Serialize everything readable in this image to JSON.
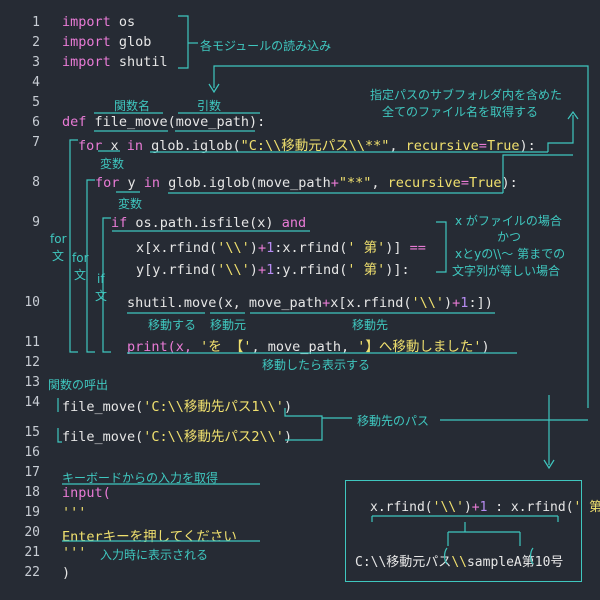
{
  "line_numbers": [
    "1",
    "2",
    "3",
    "4",
    "5",
    "6",
    "7",
    "8",
    "9",
    "10",
    "11",
    "12",
    "13",
    "14",
    "15",
    "16",
    "17",
    "18",
    "19",
    "20",
    "21",
    "22"
  ],
  "code": {
    "l1_kw": "import",
    "l1_mod": " os",
    "l2_kw": "import",
    "l2_mod": " glob",
    "l3_kw": "import",
    "l3_mod": " shutil",
    "l6_def": "def",
    "l6_name": " file_move",
    "l6_arg": "(move_path):",
    "l7_for": "for",
    "l7_x": " x ",
    "l7_in": "in",
    "l7_call": " glob.iglob(",
    "l7_str": "\"C:\\\\移動元パス\\\\**\"",
    "l7_comma": ", ",
    "l7_rec": "recursive",
    "l7_eq": "=",
    "l7_true": "True",
    "l7_end": "):",
    "l8_for": "for",
    "l8_y": " y ",
    "l8_in": "in",
    "l8_call": " glob.iglob(move_path",
    "l8_plus": "+",
    "l8_str": "\"**\"",
    "l8_comma": ", ",
    "l8_rec": "recursive",
    "l8_eq": "=",
    "l8_true": "True",
    "l8_end": "):",
    "l9_if": "if",
    "l9_call": " os.path.isfile(x) ",
    "l9_and": "and",
    "l9b_a": "x[x.rfind(",
    "l9b_s1": "'\\\\'",
    "l9b_p1": ")",
    "l9b_plus": "+",
    "l9b_one": "1",
    "l9b_b": ":x.rfind(",
    "l9b_s2": "' 第'",
    "l9b_c": ")] ",
    "l9b_eq": "==",
    "l9c_a": "y[y.rfind(",
    "l9c_s1": "'\\\\'",
    "l9c_p1": ")",
    "l9c_plus": "+",
    "l9c_one": "1",
    "l9c_b": ":y.rfind(",
    "l9c_s2": "' 第'",
    "l9c_c": ")]:",
    "l10_a": "shutil.move(x, move_path",
    "l10_plus": "+",
    "l10_b": "x[x.rfind(",
    "l10_s": "'\\\\'",
    "l10_c": ")",
    "l10_plus2": "+",
    "l10_one": "1",
    "l10_d": ":])",
    "l11_a": "print(x, ",
    "l11_s1": "'を 【'",
    "l11_b": ", move_path, ",
    "l11_s2": "'】へ移動しました'",
    "l11_c": ")",
    "l14_a": "file_move(",
    "l14_s": "'C:\\\\移動先パス1\\\\'",
    "l14_c": ")",
    "l15_a": "file_move(",
    "l15_s": "'C:\\\\移動先パス2\\\\'",
    "l15_c": ")",
    "l18": "input(",
    "l19": "'''",
    "l20": "Enterキーを押してください",
    "l21": "'''",
    "l22": ")"
  },
  "annotations": {
    "imports": "各モジュールの読み込み",
    "func_name": "関数名",
    "arg": "引数",
    "glob_desc_1": "指定パスのサブフォルダ内を含めた",
    "glob_desc_2": "全てのファイル名を取得する",
    "var_x": "変数",
    "var_y": "変数",
    "for_1a": "for",
    "for_1b": "文",
    "for_2a": "for",
    "for_2b": "文",
    "if_a": "if",
    "if_b": "文",
    "cond_1": "x がファイルの場合",
    "cond_2": "かつ",
    "cond_3": "xとyの\\\\～ 第までの",
    "cond_4": "文字列が等しい場合",
    "move": "移動する",
    "src": "移動元",
    "dst": "移動先",
    "after_move": "移動したら表示する",
    "call": "関数の呼出",
    "dest_path": "移動先のパス",
    "input_desc": "キーボードからの入力を取得",
    "input_shown": "入力時に表示される"
  },
  "diagram_box": {
    "expr_a": "x.rfind(",
    "expr_s1": "'\\\\'",
    "expr_b": ")",
    "expr_plus": "+",
    "expr_one": "1",
    "expr_sep": " : ",
    "expr_c": "x.rfind(",
    "expr_s2": "' 第'",
    "expr_d": ")",
    "path_a": "C:\\\\移動元パス",
    "path_b": "\\\\",
    "path_c": "sampleA",
    "path_d": "第10号"
  },
  "colors": {
    "background": "#262b34",
    "accent": "#3fc7bf",
    "keyword": "#e97bd6",
    "string": "#f0e06e",
    "number": "#b78cf2",
    "text": "#e6e6e6"
  }
}
